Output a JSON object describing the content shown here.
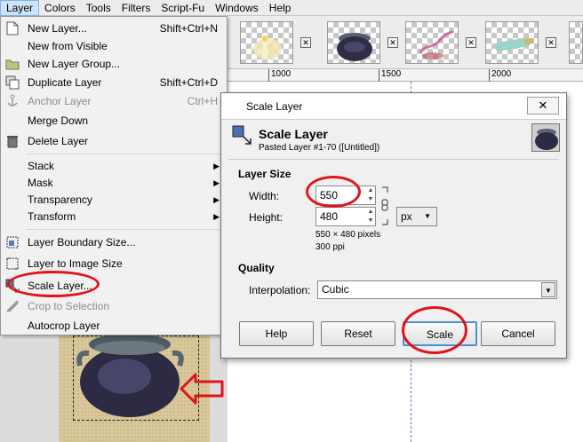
{
  "menubar": {
    "items": [
      "Layer",
      "Colors",
      "Tools",
      "Filters",
      "Script-Fu",
      "Windows",
      "Help"
    ]
  },
  "ruler": {
    "ticks": [
      "1000",
      "1500",
      "2000"
    ]
  },
  "layer_menu": {
    "items": [
      {
        "label": "New Layer...",
        "shortcut": "Shift+Ctrl+N",
        "icon": "new-layer-icon",
        "enabled": true
      },
      {
        "label": "New from Visible",
        "shortcut": "",
        "icon": "",
        "enabled": true
      },
      {
        "label": "New Layer Group...",
        "shortcut": "",
        "icon": "folder-icon",
        "enabled": true
      },
      {
        "label": "Duplicate Layer",
        "shortcut": "Shift+Ctrl+D",
        "icon": "duplicate-layer-icon",
        "enabled": true
      },
      {
        "label": "Anchor Layer",
        "shortcut": "Ctrl+H",
        "icon": "anchor-icon",
        "enabled": false
      },
      {
        "label": "Merge Down",
        "shortcut": "",
        "icon": "merge-down-icon",
        "enabled": true
      },
      {
        "label": "Delete Layer",
        "shortcut": "",
        "icon": "trash-icon",
        "enabled": true
      },
      {
        "label": "Stack",
        "submenu": true,
        "enabled": true
      },
      {
        "label": "Mask",
        "submenu": true,
        "enabled": true
      },
      {
        "label": "Transparency",
        "submenu": true,
        "enabled": true
      },
      {
        "label": "Transform",
        "submenu": true,
        "enabled": true
      },
      {
        "label": "Layer Boundary Size...",
        "shortcut": "",
        "icon": "layer-boundary-icon",
        "enabled": true
      },
      {
        "label": "Layer to Image Size",
        "shortcut": "",
        "icon": "layer-to-image-icon",
        "enabled": true
      },
      {
        "label": "Scale Layer...",
        "shortcut": "",
        "icon": "scale-layer-icon",
        "enabled": true
      },
      {
        "label": "Crop to Selection",
        "shortcut": "",
        "icon": "crop-icon",
        "enabled": false
      },
      {
        "label": "Autocrop Layer",
        "shortcut": "",
        "icon": "",
        "enabled": true
      }
    ]
  },
  "dialog": {
    "window_title": "Scale Layer",
    "close_glyph": "✕",
    "header_title": "Scale Layer",
    "header_subtitle": "Pasted Layer #1-70 ([Untitled])",
    "layer_size_label": "Layer Size",
    "width_label": "Width:",
    "width_value": "550",
    "height_label": "Height:",
    "height_value": "480",
    "size_info": "550 × 480 pixels",
    "resolution_info": "300 ppi",
    "unit": "px",
    "quality_label": "Quality",
    "interpolation_label": "Interpolation:",
    "interpolation_value": "Cubic",
    "buttons": {
      "help": "Help",
      "reset": "Reset",
      "scale": "Scale",
      "cancel": "Cancel"
    }
  },
  "colors": {
    "annotation_red": "#e0141b",
    "menu_highlight": "#cfe3f7",
    "guide_blue": "#5a78c8"
  }
}
